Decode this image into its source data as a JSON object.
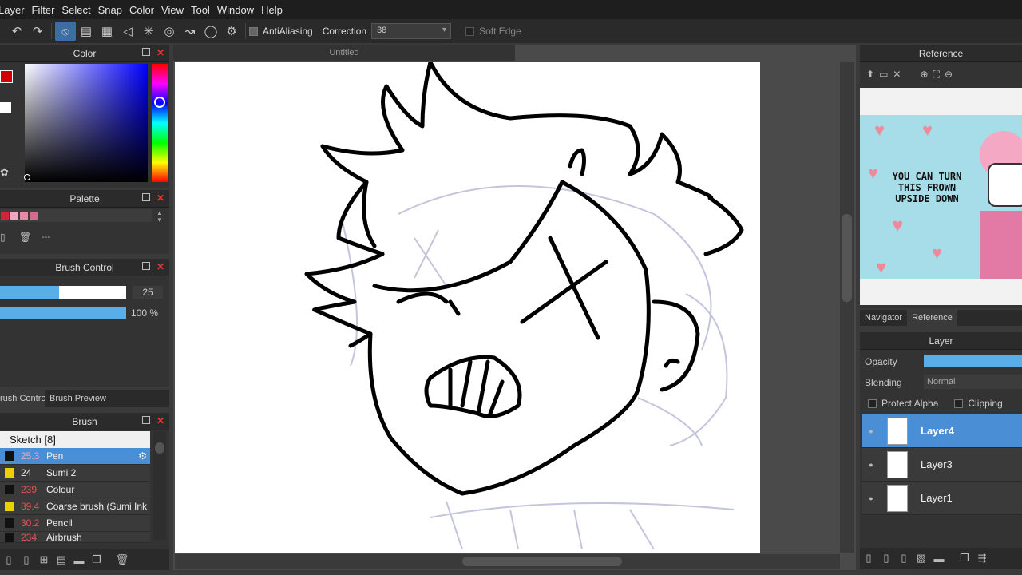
{
  "menu": [
    "Layer",
    "Filter",
    "Select",
    "Snap",
    "Color",
    "View",
    "Tool",
    "Window",
    "Help"
  ],
  "toolbar": {
    "antialiasing_label": "AntiAliasing",
    "correction_label": "Correction",
    "correction_value": "38",
    "soft_edge_label": "Soft Edge"
  },
  "color_panel": {
    "title": "Color",
    "accent_hue": "#0000ff"
  },
  "palette_panel": {
    "title": "Palette",
    "value": "---",
    "swatches": [
      "#d4243a",
      "#f2a4c0",
      "#e88aa6",
      "#d56b8c"
    ]
  },
  "brush_control": {
    "title": "Brush Control",
    "size_value": "25",
    "opacity_value": "100 %",
    "size_fraction": 0.47,
    "opacity_fraction": 1.0
  },
  "tabs_left": {
    "tab1": "rush Control",
    "tab2": "Brush Preview"
  },
  "brush_panel": {
    "title": "Brush",
    "group": "Sketch [8]",
    "items": [
      {
        "size": "25.3",
        "name": "Pen",
        "color": "#111111",
        "selected": true
      },
      {
        "size": "24",
        "name": "Sumi 2",
        "color": "#e8d200",
        "selected": false
      },
      {
        "size": "239",
        "name": "Colour",
        "color": "#111111",
        "selected": false
      },
      {
        "size": "89.4",
        "name": "Coarse brush (Sumi Ink",
        "color": "#e8d200",
        "selected": false
      },
      {
        "size": "30.2",
        "name": "Pencil",
        "color": "#111111",
        "selected": false
      },
      {
        "size": "234",
        "name": "Airbrush",
        "color": "#111111",
        "selected": false
      }
    ]
  },
  "document": {
    "title": "Untitled"
  },
  "reference_panel": {
    "title": "Reference",
    "image_text_1": "YOU CAN TURN",
    "image_text_2": "THIS FROWN",
    "image_text_3": "UPSIDE DOWN"
  },
  "right_tabs": {
    "navigator": "Navigator",
    "reference": "Reference"
  },
  "layer_panel": {
    "title": "Layer",
    "opacity_label": "Opacity",
    "blending_label": "Blending",
    "blending_value": "Normal",
    "protect_alpha_label": "Protect Alpha",
    "clipping_label": "Clipping",
    "layers": [
      {
        "name": "Layer4",
        "selected": true
      },
      {
        "name": "Layer3",
        "selected": false
      },
      {
        "name": "Layer1",
        "selected": false
      }
    ]
  }
}
